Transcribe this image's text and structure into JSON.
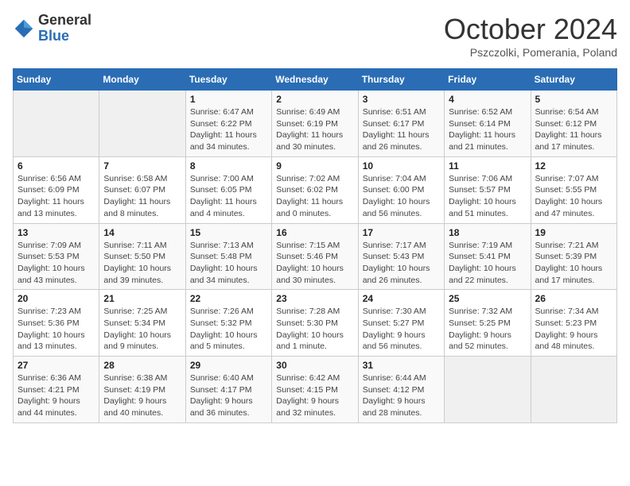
{
  "logo": {
    "general": "General",
    "blue": "Blue"
  },
  "title": "October 2024",
  "subtitle": "Pszczolki, Pomerania, Poland",
  "days_of_week": [
    "Sunday",
    "Monday",
    "Tuesday",
    "Wednesday",
    "Thursday",
    "Friday",
    "Saturday"
  ],
  "weeks": [
    [
      {
        "day": "",
        "info": ""
      },
      {
        "day": "",
        "info": ""
      },
      {
        "day": "1",
        "info": "Sunrise: 6:47 AM\nSunset: 6:22 PM\nDaylight: 11 hours\nand 34 minutes."
      },
      {
        "day": "2",
        "info": "Sunrise: 6:49 AM\nSunset: 6:19 PM\nDaylight: 11 hours\nand 30 minutes."
      },
      {
        "day": "3",
        "info": "Sunrise: 6:51 AM\nSunset: 6:17 PM\nDaylight: 11 hours\nand 26 minutes."
      },
      {
        "day": "4",
        "info": "Sunrise: 6:52 AM\nSunset: 6:14 PM\nDaylight: 11 hours\nand 21 minutes."
      },
      {
        "day": "5",
        "info": "Sunrise: 6:54 AM\nSunset: 6:12 PM\nDaylight: 11 hours\nand 17 minutes."
      }
    ],
    [
      {
        "day": "6",
        "info": "Sunrise: 6:56 AM\nSunset: 6:09 PM\nDaylight: 11 hours\nand 13 minutes."
      },
      {
        "day": "7",
        "info": "Sunrise: 6:58 AM\nSunset: 6:07 PM\nDaylight: 11 hours\nand 8 minutes."
      },
      {
        "day": "8",
        "info": "Sunrise: 7:00 AM\nSunset: 6:05 PM\nDaylight: 11 hours\nand 4 minutes."
      },
      {
        "day": "9",
        "info": "Sunrise: 7:02 AM\nSunset: 6:02 PM\nDaylight: 11 hours\nand 0 minutes."
      },
      {
        "day": "10",
        "info": "Sunrise: 7:04 AM\nSunset: 6:00 PM\nDaylight: 10 hours\nand 56 minutes."
      },
      {
        "day": "11",
        "info": "Sunrise: 7:06 AM\nSunset: 5:57 PM\nDaylight: 10 hours\nand 51 minutes."
      },
      {
        "day": "12",
        "info": "Sunrise: 7:07 AM\nSunset: 5:55 PM\nDaylight: 10 hours\nand 47 minutes."
      }
    ],
    [
      {
        "day": "13",
        "info": "Sunrise: 7:09 AM\nSunset: 5:53 PM\nDaylight: 10 hours\nand 43 minutes."
      },
      {
        "day": "14",
        "info": "Sunrise: 7:11 AM\nSunset: 5:50 PM\nDaylight: 10 hours\nand 39 minutes."
      },
      {
        "day": "15",
        "info": "Sunrise: 7:13 AM\nSunset: 5:48 PM\nDaylight: 10 hours\nand 34 minutes."
      },
      {
        "day": "16",
        "info": "Sunrise: 7:15 AM\nSunset: 5:46 PM\nDaylight: 10 hours\nand 30 minutes."
      },
      {
        "day": "17",
        "info": "Sunrise: 7:17 AM\nSunset: 5:43 PM\nDaylight: 10 hours\nand 26 minutes."
      },
      {
        "day": "18",
        "info": "Sunrise: 7:19 AM\nSunset: 5:41 PM\nDaylight: 10 hours\nand 22 minutes."
      },
      {
        "day": "19",
        "info": "Sunrise: 7:21 AM\nSunset: 5:39 PM\nDaylight: 10 hours\nand 17 minutes."
      }
    ],
    [
      {
        "day": "20",
        "info": "Sunrise: 7:23 AM\nSunset: 5:36 PM\nDaylight: 10 hours\nand 13 minutes."
      },
      {
        "day": "21",
        "info": "Sunrise: 7:25 AM\nSunset: 5:34 PM\nDaylight: 10 hours\nand 9 minutes."
      },
      {
        "day": "22",
        "info": "Sunrise: 7:26 AM\nSunset: 5:32 PM\nDaylight: 10 hours\nand 5 minutes."
      },
      {
        "day": "23",
        "info": "Sunrise: 7:28 AM\nSunset: 5:30 PM\nDaylight: 10 hours\nand 1 minute."
      },
      {
        "day": "24",
        "info": "Sunrise: 7:30 AM\nSunset: 5:27 PM\nDaylight: 9 hours\nand 56 minutes."
      },
      {
        "day": "25",
        "info": "Sunrise: 7:32 AM\nSunset: 5:25 PM\nDaylight: 9 hours\nand 52 minutes."
      },
      {
        "day": "26",
        "info": "Sunrise: 7:34 AM\nSunset: 5:23 PM\nDaylight: 9 hours\nand 48 minutes."
      }
    ],
    [
      {
        "day": "27",
        "info": "Sunrise: 6:36 AM\nSunset: 4:21 PM\nDaylight: 9 hours\nand 44 minutes."
      },
      {
        "day": "28",
        "info": "Sunrise: 6:38 AM\nSunset: 4:19 PM\nDaylight: 9 hours\nand 40 minutes."
      },
      {
        "day": "29",
        "info": "Sunrise: 6:40 AM\nSunset: 4:17 PM\nDaylight: 9 hours\nand 36 minutes."
      },
      {
        "day": "30",
        "info": "Sunrise: 6:42 AM\nSunset: 4:15 PM\nDaylight: 9 hours\nand 32 minutes."
      },
      {
        "day": "31",
        "info": "Sunrise: 6:44 AM\nSunset: 4:12 PM\nDaylight: 9 hours\nand 28 minutes."
      },
      {
        "day": "",
        "info": ""
      },
      {
        "day": "",
        "info": ""
      }
    ]
  ]
}
